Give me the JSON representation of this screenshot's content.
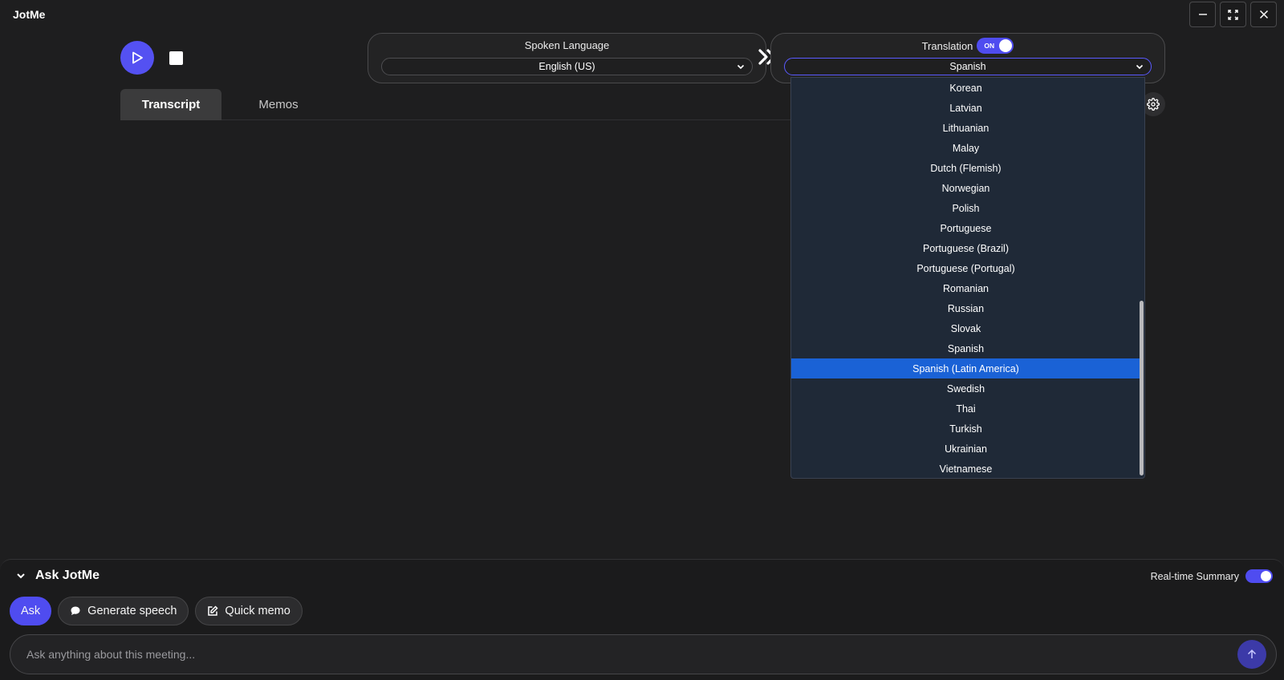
{
  "app": {
    "title": "JotMe"
  },
  "window_controls": [
    "minimize-icon",
    "fullscreen-icon",
    "close-icon"
  ],
  "player": {
    "play_icon": "play-icon",
    "stop_icon": "stop-icon"
  },
  "spoken_language": {
    "label": "Spoken Language",
    "selected": "English (US)"
  },
  "translation": {
    "label": "Translation",
    "toggle_text": "ON",
    "enabled": true,
    "selected": "Spanish"
  },
  "tabs": [
    {
      "label": "Transcript",
      "active": true
    },
    {
      "label": "Memos",
      "active": false
    }
  ],
  "dropdown": {
    "options": [
      "Korean",
      "Latvian",
      "Lithuanian",
      "Malay",
      "Dutch (Flemish)",
      "Norwegian",
      "Polish",
      "Portuguese",
      "Portuguese (Brazil)",
      "Portuguese (Portugal)",
      "Romanian",
      "Russian",
      "Slovak",
      "Spanish",
      "Spanish (Latin America)",
      "Swedish",
      "Thai",
      "Turkish",
      "Ukrainian",
      "Vietnamese"
    ],
    "highlighted": "Spanish (Latin America)"
  },
  "ask": {
    "title": "Ask JotMe",
    "summary_label": "Real-time Summary",
    "summary_enabled": true,
    "buttons": {
      "ask": "Ask",
      "generate_speech": "Generate speech",
      "quick_memo": "Quick memo"
    },
    "placeholder": "Ask anything about this meeting..."
  },
  "colors": {
    "accent": "#5451f2",
    "highlight": "#1a62d6",
    "background": "#1e1e1f",
    "dropdown_bg": "#1f2937"
  }
}
